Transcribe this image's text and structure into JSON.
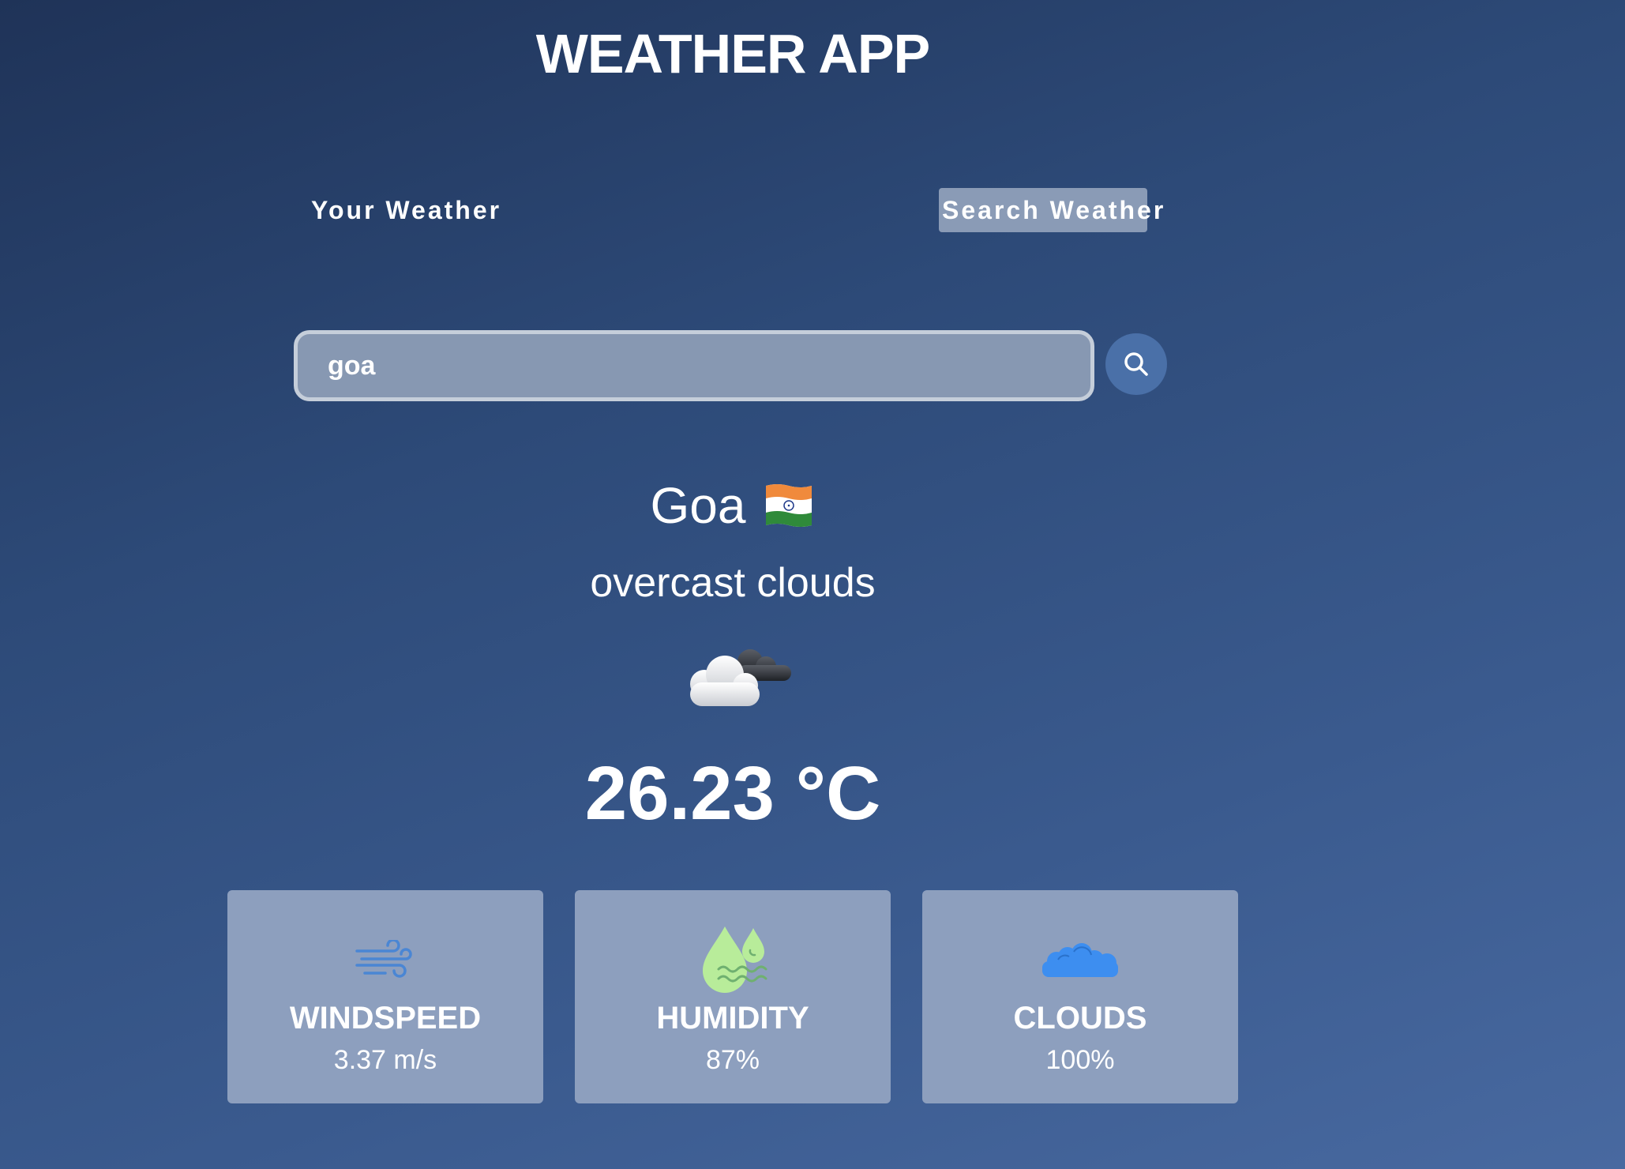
{
  "header": {
    "title": "WEATHER APP"
  },
  "tabs": [
    {
      "label": "Your Weather",
      "active": false
    },
    {
      "label": "Search Weather",
      "active": true
    }
  ],
  "search": {
    "value": "goa",
    "button_icon": "search-icon"
  },
  "weather": {
    "city": "Goa",
    "country_flag": "india-flag-icon",
    "description": "overcast clouds",
    "icon": "overcast-clouds-icon",
    "temperature": "26.23 °C"
  },
  "stats": [
    {
      "label": "WINDSPEED",
      "value": "3.37 m/s",
      "icon": "wind-icon"
    },
    {
      "label": "HUMIDITY",
      "value": "87%",
      "icon": "humidity-icon"
    },
    {
      "label": "CLOUDS",
      "value": "100%",
      "icon": "clouds-icon"
    }
  ],
  "colors": {
    "active_tab": "#8a9bb6",
    "search_button": "#4a70a8",
    "card_background": "#8d9fbe",
    "wind_icon": "#4a86d4",
    "humidity_icon": "#b8ec9a",
    "clouds_icon": "#3d8ef0"
  }
}
